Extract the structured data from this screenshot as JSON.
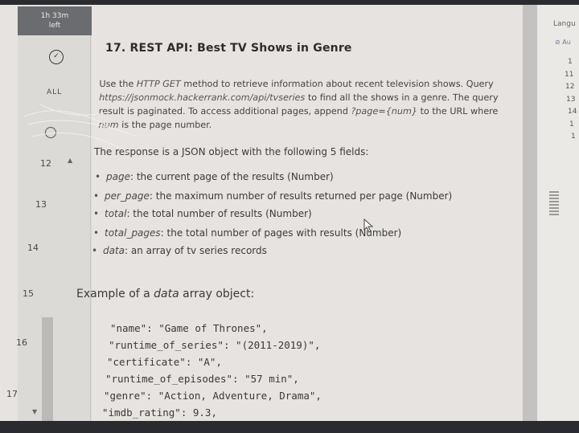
{
  "timer": {
    "line1": "1h 33m",
    "line2": "left"
  },
  "rail": {
    "question_badge": "✓",
    "all_tag": "ALL",
    "line_numbers": [
      "12",
      "13",
      "14",
      "15",
      "16",
      "17"
    ]
  },
  "question": {
    "title": "17. REST API: Best TV Shows in Genre",
    "p1": "Use the ",
    "p1_method": "HTTP GET",
    "p2": " method to retrieve information about recent television shows. Query ",
    "p2_url": "https://jsonmock.hackerrank.com/api/tvseries",
    "p3": " to find all the shows in a genre. The query result is paginated. To access additional pages, append ",
    "p3_param": "?page={num}",
    "p4": " to the URL where ",
    "p4_num": "num",
    "p5": " is the page number.",
    "response_intro": "The response is a JSON object with the following 5 fields:",
    "fields": [
      {
        "name": "page",
        "desc": ": the current page of the results (Number)"
      },
      {
        "name": "per_page",
        "desc": ": the maximum number of results returned per page (Number)"
      },
      {
        "name": "total",
        "desc": ": the total number of results (Number)"
      },
      {
        "name": "total_pages",
        "desc": ": the total number of pages with results (Number)"
      },
      {
        "name": "data",
        "desc": ": an array of tv series records"
      }
    ],
    "example_pre": "Example of a ",
    "example_word": "data",
    "example_post": " array object:",
    "code_lines": [
      "\"name\": \"Game of Thrones\",",
      "\"runtime_of_series\": \"(2011-2019)\",",
      "\"certificate\": \"A\",",
      "\"runtime_of_episodes\": \"57 min\",",
      "\"genre\": \"Action, Adventure, Drama\",",
      "\"imdb_rating\": 9.3,"
    ]
  },
  "right_panel": {
    "language_label": "Langu",
    "autocomplete_label": "⊘ Au",
    "line_numbers": [
      "1",
      "11",
      "12",
      "13",
      "14",
      "1",
      "1"
    ]
  },
  "colors": {
    "screen_bg": "#e6e3e0",
    "timer_bg": "#6a6c70",
    "text": "#3b3b3b"
  }
}
